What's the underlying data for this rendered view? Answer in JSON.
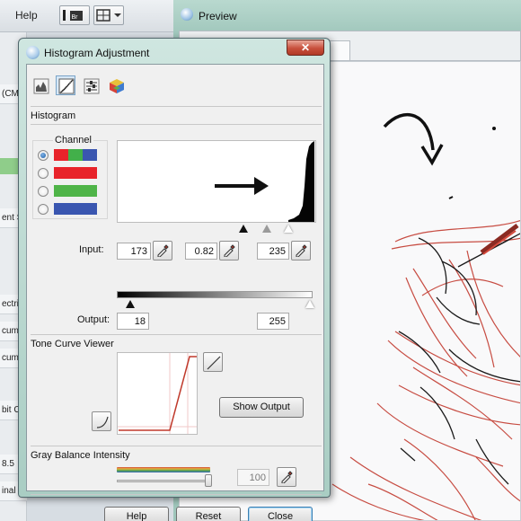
{
  "background_app": {
    "menu_help": "Help",
    "side_items": [
      "(CM",
      "ent S",
      "ectri",
      "cume",
      "cume",
      "bit C",
      "8.5",
      "inal"
    ]
  },
  "preview": {
    "title": "Preview",
    "tab_fragment": "m"
  },
  "dialog": {
    "title": "Histogram Adjustment",
    "close_glyph": "✕",
    "tools": [
      "histogram-tool",
      "tone-curve-tool",
      "color-balance-tool",
      "color-cube-tool"
    ],
    "histogram_section": "Histogram",
    "channel_label": "Channel",
    "channels": [
      {
        "name": "RGB",
        "colors": [
          "#e8232a",
          "#42b04a",
          "#3a56b0"
        ],
        "selected": true
      },
      {
        "name": "Red",
        "colors": [
          "#e8232a"
        ],
        "selected": false
      },
      {
        "name": "Green",
        "colors": [
          "#4fb448"
        ],
        "selected": false
      },
      {
        "name": "Blue",
        "colors": [
          "#3a56b0"
        ],
        "selected": false
      }
    ],
    "input_label": "Input:",
    "input_shadow": "173",
    "input_gamma": "0.82",
    "input_highlight": "235",
    "output_label": "Output:",
    "output_shadow": "18",
    "output_highlight": "255",
    "tone_curve_section": "Tone Curve Viewer",
    "show_output_label": "Show Output",
    "gray_balance_section": "Gray Balance Intensity",
    "gray_balance_value": "100",
    "help_label": "Help",
    "reset_label": "Reset",
    "close_label": "Close"
  }
}
